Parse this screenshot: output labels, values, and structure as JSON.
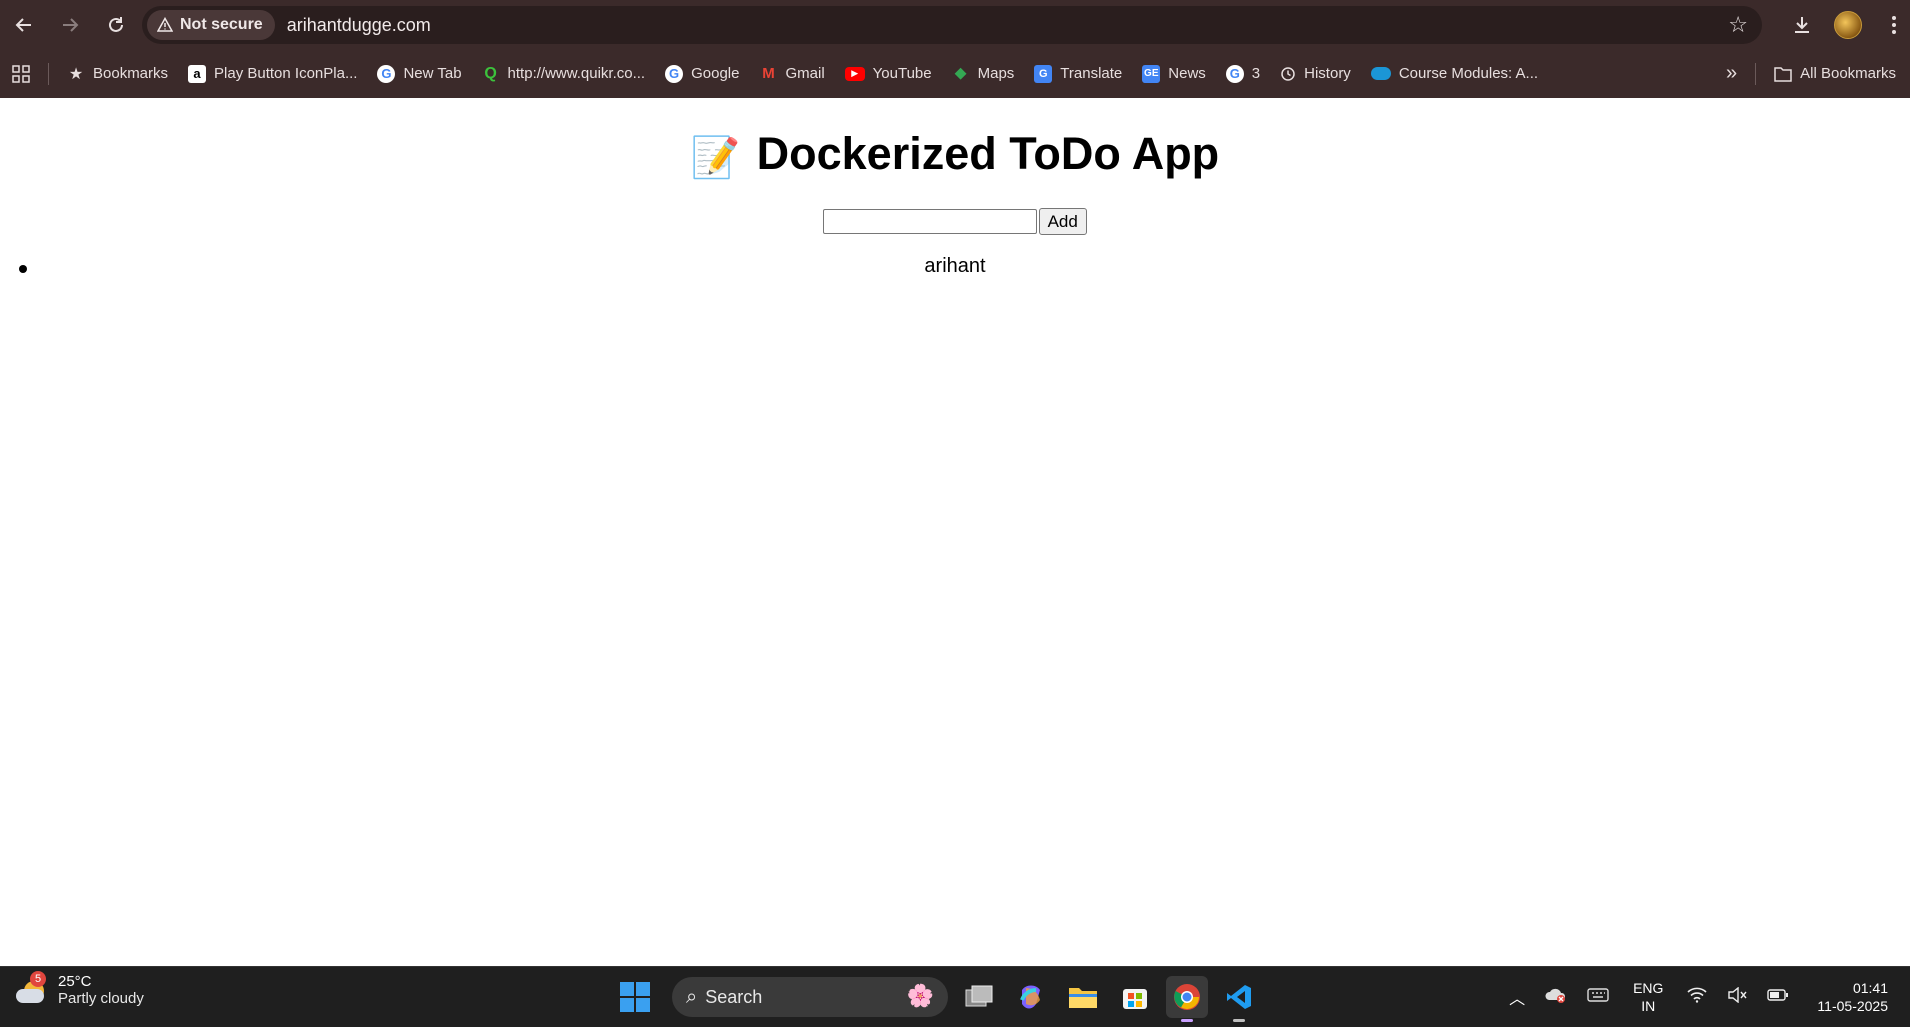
{
  "browser": {
    "security_label": "Not secure",
    "url": "arihantdugge.com",
    "bookmarks": [
      {
        "label": "Bookmarks",
        "icon": "star-icon"
      },
      {
        "label": "Play Button IconPla...",
        "icon": "amazon-icon"
      },
      {
        "label": "New Tab",
        "icon": "google-icon"
      },
      {
        "label": "http://www.quikr.co...",
        "icon": "quikr-icon"
      },
      {
        "label": "Google",
        "icon": "google-icon"
      },
      {
        "label": "Gmail",
        "icon": "gmail-icon"
      },
      {
        "label": "YouTube",
        "icon": "youtube-icon"
      },
      {
        "label": "Maps",
        "icon": "maps-icon"
      },
      {
        "label": "Translate",
        "icon": "translate-icon"
      },
      {
        "label": "News",
        "icon": "news-icon"
      },
      {
        "label": "3",
        "icon": "google-icon"
      },
      {
        "label": "History",
        "icon": "history-icon"
      },
      {
        "label": "Course Modules: A...",
        "icon": "cloud-icon"
      }
    ],
    "all_bookmarks_label": "All Bookmarks"
  },
  "page": {
    "title": "Dockerized ToDo App",
    "title_emoji": "📝",
    "input_value": "",
    "add_button_label": "Add",
    "todos": [
      "arihant"
    ]
  },
  "taskbar": {
    "weather_badge": "5",
    "temperature": "25°C",
    "weather_desc": "Partly cloudy",
    "search_label": "Search",
    "lang_line1": "ENG",
    "lang_line2": "IN",
    "time": "01:41",
    "date": "11-05-2025"
  }
}
